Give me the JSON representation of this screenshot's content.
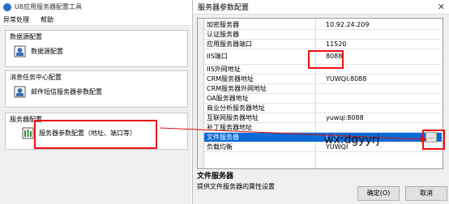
{
  "left_window": {
    "title": "U8应用服务器配置工具",
    "menu": [
      "异常处理",
      "帮助"
    ],
    "groups": [
      {
        "title": "数据源配置",
        "button": "数据源配置"
      },
      {
        "title": "消息任务中心配置",
        "button": "邮件短信服务器参数配置"
      },
      {
        "title": "服务器配置",
        "button": "服务器参数配置（地址、端口等）"
      }
    ]
  },
  "right_window": {
    "title": "服务器参数配置",
    "properties": [
      {
        "name": "加密服务器",
        "value": "10.92.24.209"
      },
      {
        "name": "认证服务器",
        "value": ""
      },
      {
        "name": "应用服务器端口",
        "value": "11520"
      },
      {
        "name": "IIS端口",
        "value": "8088"
      },
      {
        "name": "IIS外网地址",
        "value": ""
      },
      {
        "name": "CRM服务器地址",
        "value": "YUWQI:8088"
      },
      {
        "name": "CRM服务器外网地址",
        "value": ""
      },
      {
        "name": "OA服务器地址",
        "value": ""
      },
      {
        "name": "商业分析服务器地址",
        "value": ""
      },
      {
        "name": "互联网服务器地址",
        "value": "yuwqi:8088"
      },
      {
        "name": "补丁服务器地址",
        "value": ""
      },
      {
        "name": "文件服务器",
        "value": "(...)"
      },
      {
        "name": "负载均衡",
        "value": "YUWQI"
      }
    ],
    "ellipsis": "...",
    "description_title": "文件服务器",
    "description_text": "提供文件服务器的属性设置",
    "ok_label": "确定(O)",
    "cancel_label": "取消"
  },
  "watermark": "wx:dgyyrj",
  "annotation_color": "#e11111"
}
